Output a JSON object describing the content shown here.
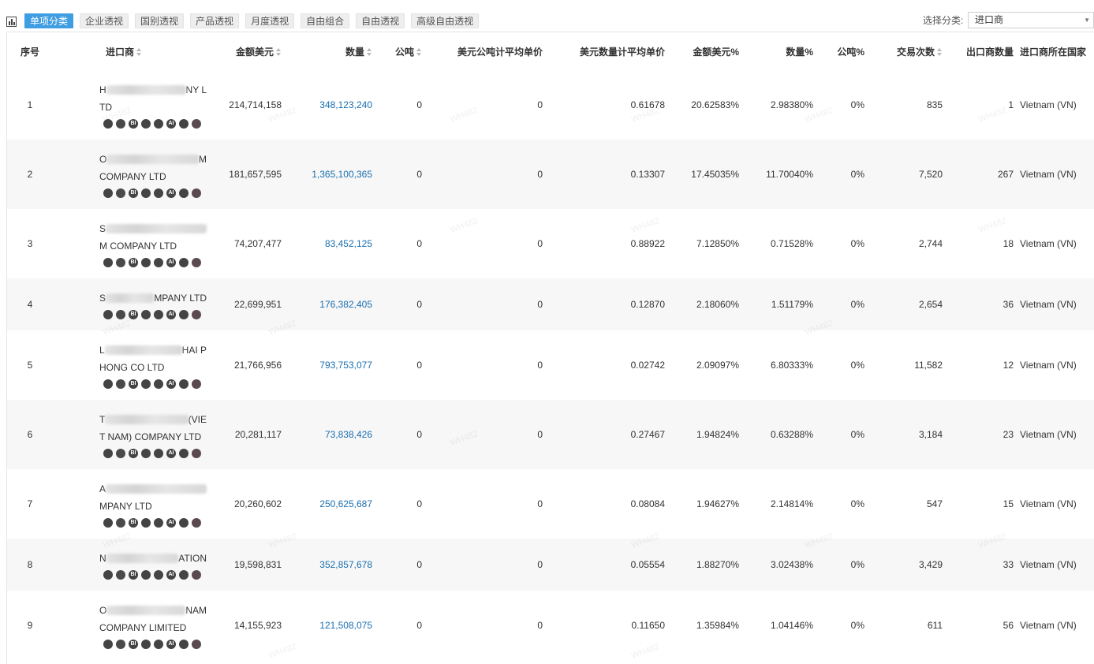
{
  "toolbar": {
    "tabs": [
      "单项分类",
      "企业透视",
      "国别透视",
      "产品透视",
      "月度透视",
      "自由组合",
      "自由透视",
      "高级自由透视"
    ],
    "select_label": "选择分类:",
    "select_value": "进口商"
  },
  "table": {
    "headers": {
      "idx": "序号",
      "importer": "进口商",
      "amount_usd": "金额美元",
      "quantity": "数量",
      "tons": "公吨",
      "usd_per_ton": "美元公吨计平均单价",
      "usd_per_qty": "美元数量计平均单价",
      "amount_pct": "金额美元%",
      "qty_pct": "数量%",
      "tons_pct": "公吨%",
      "transactions": "交易次数",
      "exporters": "出口商数量",
      "country": "进口商所在国家"
    },
    "rows": [
      {
        "idx": "1",
        "name_a": "H",
        "name_a_end": "NY L",
        "name_b": "TD",
        "amount": "214,714,158",
        "qty": "348,123,240",
        "tons": "0",
        "ppt": "0",
        "ppq": "0.61678",
        "apct": "20.62583%",
        "qpct": "2.98380%",
        "tpct": "0%",
        "tx": "835",
        "exp": "1",
        "country": "Vietnam (VN)"
      },
      {
        "idx": "2",
        "name_a": "O",
        "name_a_end": "M",
        "name_b": "COMPANY LTD",
        "amount": "181,657,595",
        "qty": "1,365,100,365",
        "tons": "0",
        "ppt": "0",
        "ppq": "0.13307",
        "apct": "17.45035%",
        "qpct": "11.70040%",
        "tpct": "0%",
        "tx": "7,520",
        "exp": "267",
        "country": "Vietnam (VN)"
      },
      {
        "idx": "3",
        "name_a": "S",
        "name_a_end": "",
        "name_b": "M COMPANY LTD",
        "amount": "74,207,477",
        "qty": "83,452,125",
        "tons": "0",
        "ppt": "0",
        "ppq": "0.88922",
        "apct": "7.12850%",
        "qpct": "0.71528%",
        "tpct": "0%",
        "tx": "2,744",
        "exp": "18",
        "country": "Vietnam (VN)"
      },
      {
        "idx": "4",
        "name_a": "S",
        "name_a_end": "MPANY LTD",
        "name_b": "",
        "amount": "22,699,951",
        "qty": "176,382,405",
        "tons": "0",
        "ppt": "0",
        "ppq": "0.12870",
        "apct": "2.18060%",
        "qpct": "1.51179%",
        "tpct": "0%",
        "tx": "2,654",
        "exp": "36",
        "country": "Vietnam (VN)"
      },
      {
        "idx": "5",
        "name_a": "L",
        "name_a_end": "HAI P",
        "name_b": "HONG CO LTD",
        "amount": "21,766,956",
        "qty": "793,753,077",
        "tons": "0",
        "ppt": "0",
        "ppq": "0.02742",
        "apct": "2.09097%",
        "qpct": "6.80333%",
        "tpct": "0%",
        "tx": "11,582",
        "exp": "12",
        "country": "Vietnam (VN)"
      },
      {
        "idx": "6",
        "name_a": "T",
        "name_a_end": "(VIE",
        "name_b": "T NAM) COMPANY LTD",
        "amount": "20,281,117",
        "qty": "73,838,426",
        "tons": "0",
        "ppt": "0",
        "ppq": "0.27467",
        "apct": "1.94824%",
        "qpct": "0.63288%",
        "tpct": "0%",
        "tx": "3,184",
        "exp": "23",
        "country": "Vietnam (VN)"
      },
      {
        "idx": "7",
        "name_a": "A",
        "name_a_end": "",
        "name_b": "MPANY LTD",
        "amount": "20,260,602",
        "qty": "250,625,687",
        "tons": "0",
        "ppt": "0",
        "ppq": "0.08084",
        "apct": "1.94627%",
        "qpct": "2.14814%",
        "tpct": "0%",
        "tx": "547",
        "exp": "15",
        "country": "Vietnam (VN)"
      },
      {
        "idx": "8",
        "name_a": "N",
        "name_a_end": "ATION",
        "name_b": "",
        "amount": "19,598,831",
        "qty": "352,857,678",
        "tons": "0",
        "ppt": "0",
        "ppq": "0.05554",
        "apct": "1.88270%",
        "qpct": "3.02438%",
        "tpct": "0%",
        "tx": "3,429",
        "exp": "33",
        "country": "Vietnam (VN)"
      },
      {
        "idx": "9",
        "name_a": "O",
        "name_a_end": "NAM",
        "name_b": "COMPANY LIMITED",
        "amount": "14,155,923",
        "qty": "121,508,075",
        "tons": "0",
        "ppt": "0",
        "ppq": "0.11650",
        "apct": "1.35984%",
        "qpct": "1.04146%",
        "tpct": "0%",
        "tx": "611",
        "exp": "56",
        "country": "Vietnam (VN)"
      }
    ],
    "row_icons": [
      "target-icon",
      "compass-icon",
      "bi-icon",
      "circle-icon",
      "globe-icon",
      "ai-icon",
      "people-icon",
      "network-icon"
    ],
    "icon_glyphs": {
      "bi-icon": "BI",
      "ai-icon": "AI"
    }
  },
  "watermark": "WH482"
}
